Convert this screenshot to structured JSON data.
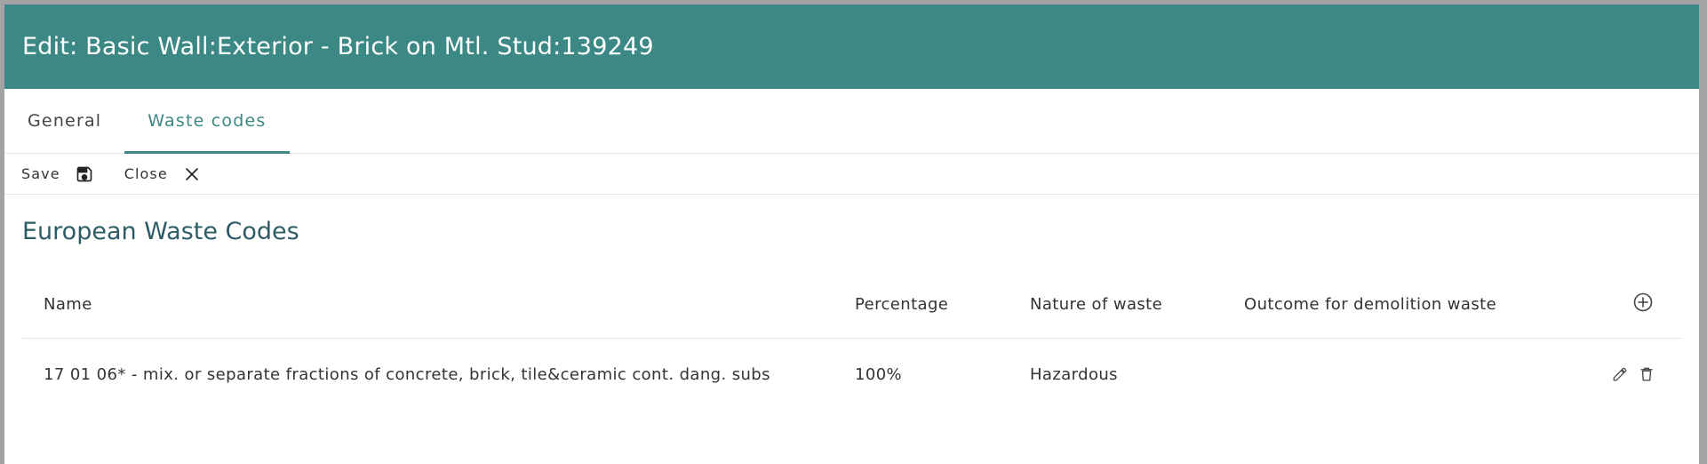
{
  "dialog": {
    "title": "Edit: Basic Wall:Exterior - Brick on Mtl. Stud:139249"
  },
  "tabs": [
    {
      "label": "General",
      "active": false
    },
    {
      "label": "Waste codes",
      "active": true
    }
  ],
  "toolbar": {
    "save_label": "Save",
    "save_icon": "floppy-disk-icon",
    "close_label": "Close",
    "close_icon": "x-close-icon"
  },
  "section": {
    "title": "European Waste Codes"
  },
  "table": {
    "columns": [
      "Name",
      "Percentage",
      "Nature of waste",
      "Outcome for demolition waste"
    ],
    "add_icon": "plus-circle-icon",
    "rows": [
      {
        "name": "17 01 06* - mix. or separate fractions of concrete, brick, tile&ceramic cont. dang. subs",
        "percentage": "100%",
        "nature": "Hazardous",
        "outcome": "",
        "actions": [
          "pencil-edit-icon",
          "trash-delete-icon"
        ]
      }
    ]
  },
  "colors": {
    "header": "#3b8885",
    "accent": "#3b8885",
    "section_title": "#2e5c66"
  }
}
